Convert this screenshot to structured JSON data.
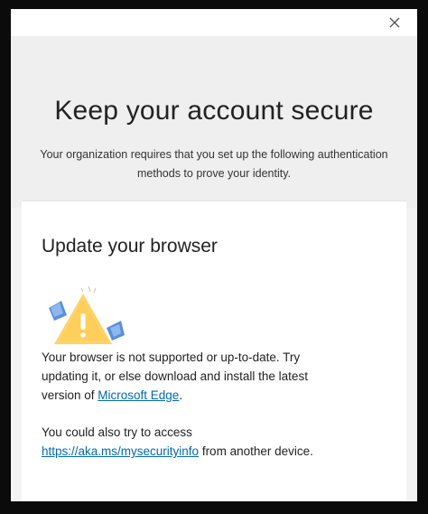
{
  "dialog": {
    "close_symbol": "×",
    "title": "Keep your account secure",
    "subtitle": "Your organization requires that you set up the following authentication methods to prove your identity."
  },
  "card": {
    "title": "Update your browser",
    "icon": "warning-illustration",
    "paragraph1": {
      "text_before": "Your browser is not supported or up-to-date. Try updating it, or else download and install the latest version of ",
      "link": "Microsoft Edge",
      "text_after": "."
    },
    "paragraph2": {
      "text_before": "You could also try to access ",
      "link": "https://aka.ms/mysecurityinfo",
      "text_after": " from another device."
    }
  },
  "colors": {
    "link": "#0067b8",
    "warning_fill": "#ffd36b",
    "accent_blue": "#5b8fd6"
  }
}
